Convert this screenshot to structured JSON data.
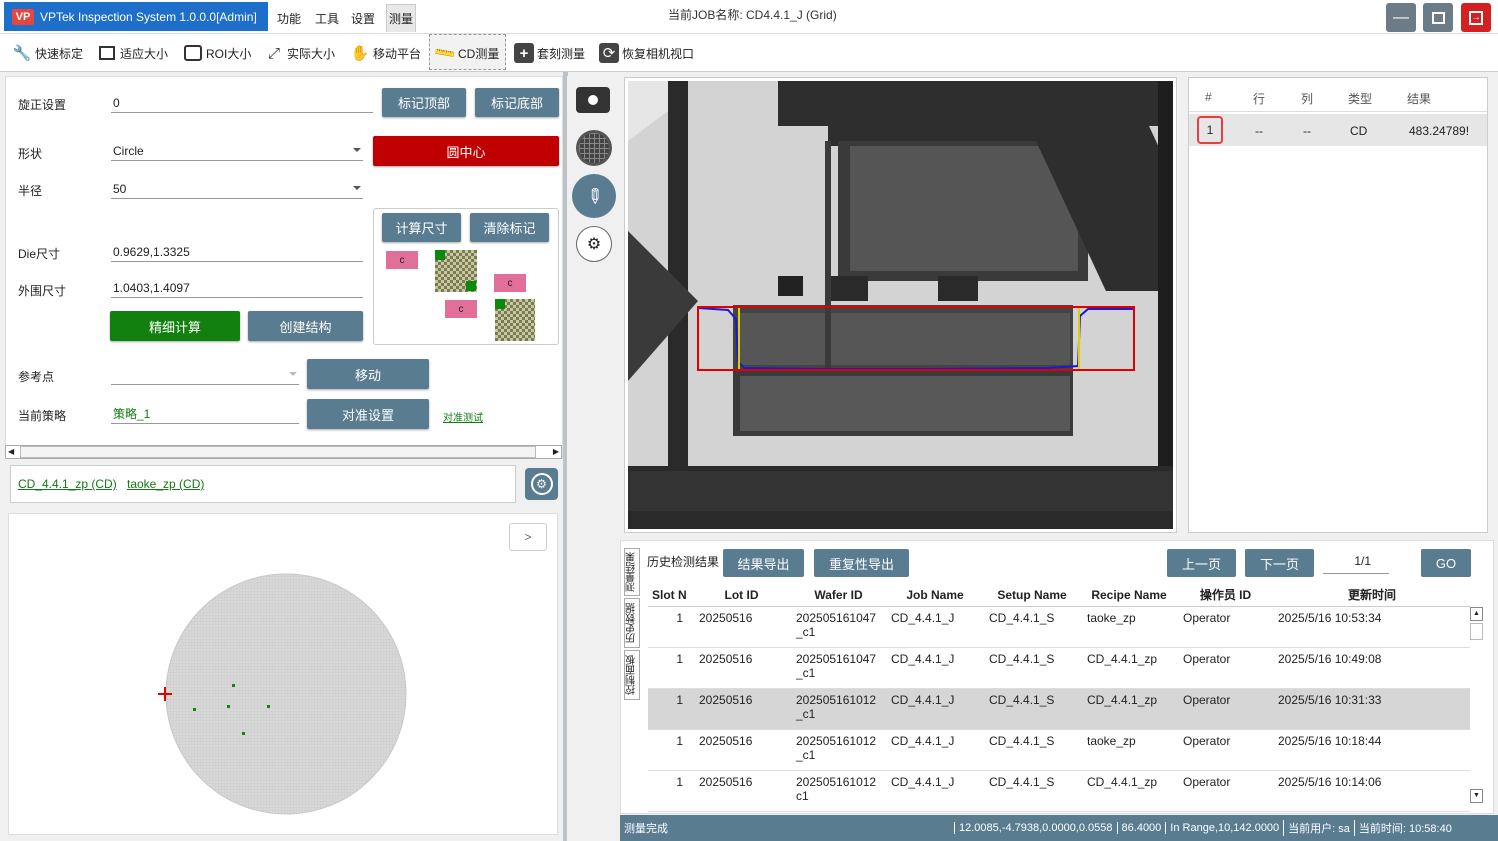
{
  "app": {
    "title": "VPTek Inspection System 1.0.0.0[Admin]",
    "logo_text": "VP",
    "job_label": "当前JOB名称: CD4.4.1_J (Grid)"
  },
  "menu": [
    "功能",
    "工具",
    "设置",
    "测量"
  ],
  "toolbar": [
    {
      "label": "快速标定",
      "icon": "wrench-icon"
    },
    {
      "label": "适应大小",
      "icon": "fit-size-icon"
    },
    {
      "label": "ROI大小",
      "icon": "roi-size-icon"
    },
    {
      "label": "实际大小",
      "icon": "actual-size-icon"
    },
    {
      "label": "移动平台",
      "icon": "hand-move-icon"
    },
    {
      "label": "CD测量",
      "icon": "ruler-icon"
    },
    {
      "label": "套刻测量",
      "icon": "plus-icon"
    },
    {
      "label": "恢复相机视口",
      "icon": "restore-camera-icon"
    }
  ],
  "settings": {
    "rotate_label": "旋正设置",
    "rotate_value": "0",
    "shape_label": "形状",
    "shape_value": "Circle",
    "radius_label": "半径",
    "radius_value": "50",
    "die_label": "Die尺寸",
    "die_value": "0.9629,1.3325",
    "outer_label": "外围尺寸",
    "outer_value": "1.0403,1.4097",
    "ref_label": "参考点",
    "ref_value": "",
    "strategy_label": "当前策略",
    "strategy_value": "策略_1",
    "btn_mark_top": "标记顶部",
    "btn_mark_bottom": "标记底部",
    "btn_circle_center": "圆中心",
    "btn_calc_size": "计算尺寸",
    "btn_clear_marks": "清除标记",
    "btn_precise": "精细计算",
    "btn_create": "创建结构",
    "btn_move": "移动",
    "btn_align": "对准设置",
    "link_align_test": "对准测试",
    "mark_c": "c"
  },
  "strategies": [
    "CD_4.4.1_zp (CD)",
    "taoke_zp (CD)"
  ],
  "wafer": {
    "next_label": ">"
  },
  "results": {
    "headers": [
      "#",
      "行",
      "列",
      "类型",
      "结果"
    ],
    "rows": [
      {
        "idx": "1",
        "row": "--",
        "col": "--",
        "type": "CD",
        "result": "483.24789!"
      }
    ]
  },
  "history": {
    "title": "历史检测结果",
    "tabs": [
      "测量结果",
      "历史数据",
      "控制面板"
    ],
    "btn_export": "结果导出",
    "btn_repeat_export": "重复性导出",
    "btn_prev": "上一页",
    "btn_next": "下一页",
    "page": "1/1",
    "btn_go": "GO",
    "headers": [
      "Slot N",
      "Lot ID",
      "Wafer ID",
      "Job Name",
      "Setup Name",
      "Recipe Name",
      "操作员 ID",
      "更新时间"
    ],
    "rows": [
      {
        "slot": "1",
        "lot": "20250516",
        "wafer": "202505161047",
        "wafer2": "_c1",
        "job": "CD_4.4.1_J",
        "setup": "CD_4.4.1_S",
        "recipe": "taoke_zp",
        "op": "Operator",
        "time": "2025/5/16 10:53:34"
      },
      {
        "slot": "1",
        "lot": "20250516",
        "wafer": "202505161047",
        "wafer2": "_c1",
        "job": "CD_4.4.1_J",
        "setup": "CD_4.4.1_S",
        "recipe": "CD_4.4.1_zp",
        "op": "Operator",
        "time": "2025/5/16 10:49:08"
      },
      {
        "slot": "1",
        "lot": "20250516",
        "wafer": "202505161012",
        "wafer2": "_c1",
        "job": "CD_4.4.1_J",
        "setup": "CD_4.4.1_S",
        "recipe": "CD_4.4.1_zp",
        "op": "Operator",
        "time": "2025/5/16 10:31:33"
      },
      {
        "slot": "1",
        "lot": "20250516",
        "wafer": "202505161012",
        "wafer2": "_c1",
        "job": "CD_4.4.1_J",
        "setup": "CD_4.4.1_S",
        "recipe": "taoke_zp",
        "op": "Operator",
        "time": "2025/5/16 10:18:44"
      },
      {
        "slot": "1",
        "lot": "20250516",
        "wafer": "202505161012",
        "wafer2": "c1",
        "job": "CD_4.4.1_J",
        "setup": "CD_4.4.1_S",
        "recipe": "CD_4.4.1_zp",
        "op": "Operator",
        "time": "2025/5/16 10:14:06"
      }
    ]
  },
  "status": {
    "message": "测量完成",
    "coords": "12.0085,-4.7938,0.0000,0.0558",
    "value": "86.4000",
    "range": "In Range,10,142.0000",
    "user": "当前用户: sa",
    "time": "当前时间: 10:58:40"
  },
  "colors": {
    "accent": "#5a7c91",
    "danger": "#c00000",
    "ok": "#11800f",
    "brand": "#1e6fc9"
  }
}
